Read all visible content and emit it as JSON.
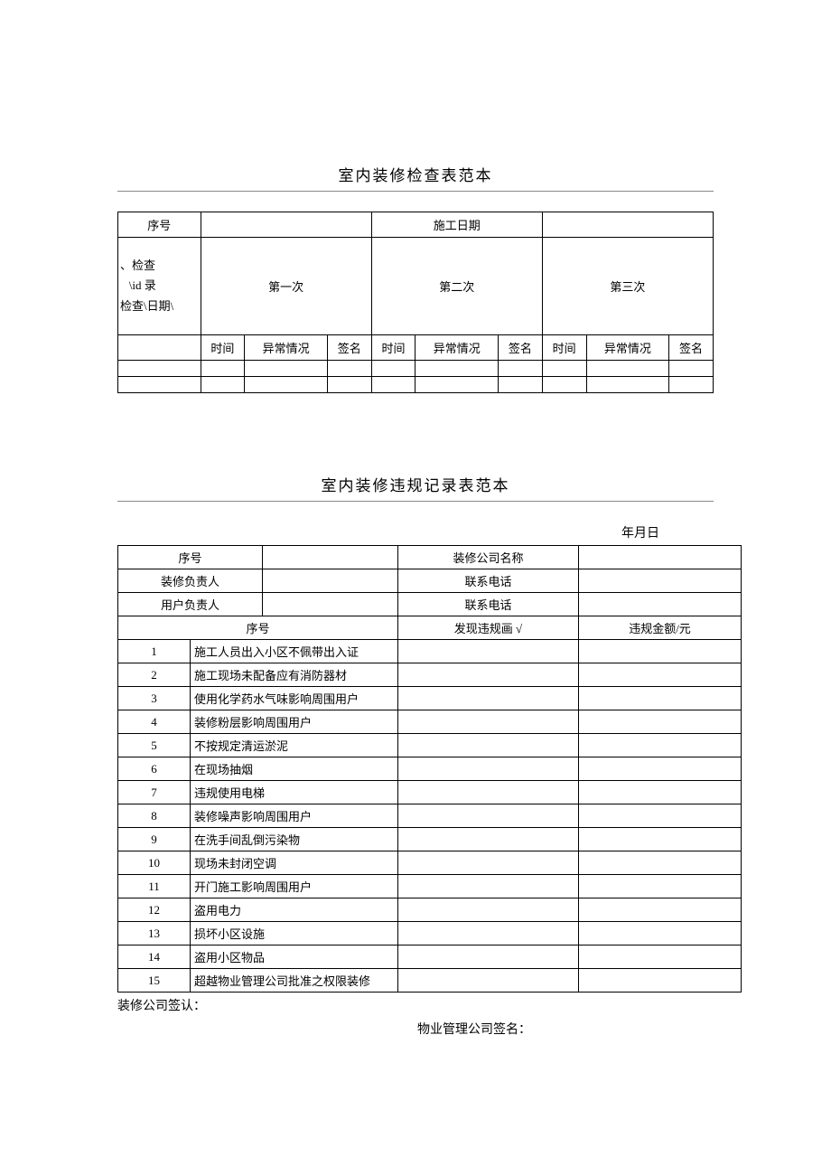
{
  "section1": {
    "title": "室内装修检查表范本",
    "h_seq": "序号",
    "h_date": "施工日期",
    "h_check_label": "、检查\n   \\id 录\n检查\\日期\\",
    "h_first": "第一次",
    "h_second": "第二次",
    "h_third": "第三次",
    "sub_time": "时间",
    "sub_abnormal": "异常情况",
    "sub_sign": "签名"
  },
  "section2": {
    "title": "室内装修违规记录表范本",
    "date_label": "年月日",
    "h_seq": "序号",
    "h_company": "装修公司名称",
    "h_reno_owner": "装修负责人",
    "h_phone": "联系电话",
    "h_user_owner": "用户负责人",
    "h_phone2": "联系电话",
    "h_seq2": "序号",
    "h_found": "发现违规画 √",
    "h_penalty": "违规金额/元",
    "items": [
      {
        "n": "1",
        "d": "施工人员出入小区不佩带出入证"
      },
      {
        "n": "2",
        "d": "施工现场未配备应有消防器材"
      },
      {
        "n": "3",
        "d": "使用化学药水气味影响周围用户"
      },
      {
        "n": "4",
        "d": "装修粉层影响周围用户"
      },
      {
        "n": "5",
        "d": "不按规定清运淤泥"
      },
      {
        "n": "6",
        "d": "在现场抽烟"
      },
      {
        "n": "7",
        "d": "违规使用电梯"
      },
      {
        "n": "8",
        "d": "装修噪声影响周围用户"
      },
      {
        "n": "9",
        "d": "在洗手间乱倒污染物"
      },
      {
        "n": "10",
        "d": "现场未封闭空调"
      },
      {
        "n": "11",
        "d": "开门施工影响周围用户"
      },
      {
        "n": "12",
        "d": "盗用电力"
      },
      {
        "n": "13",
        "d": "损坏小区设施"
      },
      {
        "n": "14",
        "d": "盗用小区物品"
      },
      {
        "n": "15",
        "d": "超越物业管理公司批准之权限装修"
      }
    ],
    "sig_reno": "装修公司签认：",
    "sig_property": "物业管理公司签名："
  }
}
